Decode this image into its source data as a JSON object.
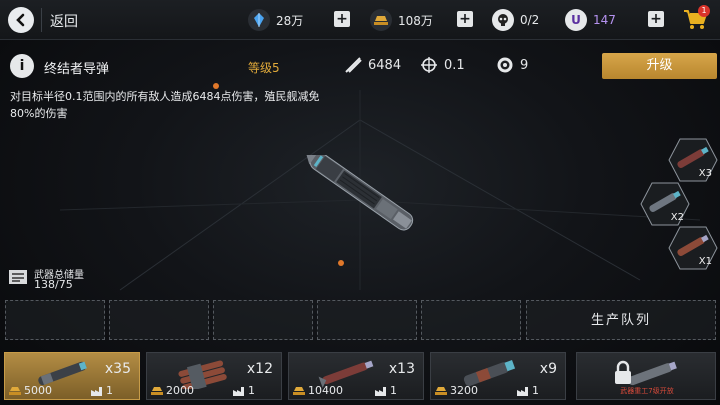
{
  "header": {
    "back_label": "返回",
    "resources": [
      {
        "icon": "crystal-icon",
        "value": "28万",
        "color": "#4aa3f0"
      },
      {
        "icon": "gold-bar-icon",
        "value": "108万",
        "color": "#e0a93a"
      },
      {
        "icon": "skull-icon",
        "value": "0/2",
        "color": "#e6e8ea"
      },
      {
        "icon": "u-token-icon",
        "value": "147",
        "color": "#9a6be0"
      }
    ],
    "cart_badge": "1"
  },
  "weapon": {
    "name": "终结者导弹",
    "level": "等级5",
    "damage": "6484",
    "radius": "0.1",
    "ammo": "9",
    "upgrade_label": "升级",
    "description": "对目标半径0.1范围内的所有敌人造成6484点伤害，殖民舰减免80%的伤害"
  },
  "side_ammo": [
    {
      "count": "X3"
    },
    {
      "count": "X2"
    },
    {
      "count": "X1"
    }
  ],
  "storage": {
    "label": "武器总储量",
    "value": "138/75"
  },
  "queue": {
    "label": "生产队列"
  },
  "inventory": [
    {
      "mult": "x35",
      "cost": "5000",
      "level": "1",
      "selected": true
    },
    {
      "mult": "x12",
      "cost": "2000",
      "level": "1",
      "selected": false
    },
    {
      "mult": "x13",
      "cost": "10400",
      "level": "1",
      "selected": false
    },
    {
      "mult": "x9",
      "cost": "3200",
      "level": "1",
      "selected": false
    },
    {
      "locked_text": "武器重工7级开放"
    }
  ],
  "colors": {
    "accent_gold": "#d7a64a",
    "level_text": "#e0a93a",
    "lock_red": "#d84a3a"
  }
}
